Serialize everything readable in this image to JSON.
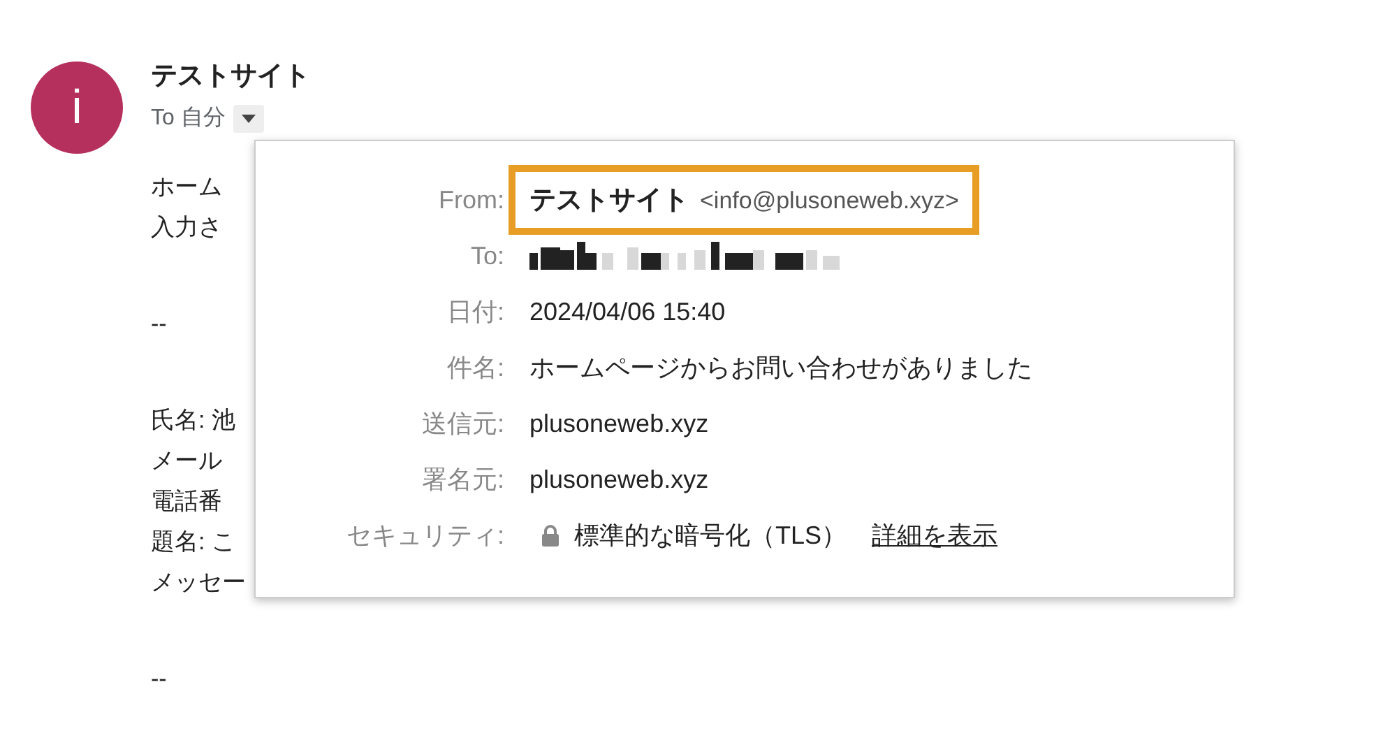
{
  "sender": {
    "avatar_letter": "i",
    "name": "テストサイト",
    "to_label": "To 自分"
  },
  "body_paragraphs": [
    [
      "ホーム",
      "入力さ"
    ],
    [
      "--"
    ],
    [
      "氏名: 池",
      "メール",
      "電話番",
      "題名: こ",
      "メッセー"
    ],
    [
      "--"
    ]
  ],
  "details": {
    "rows": [
      {
        "kind": "from",
        "label": "From:",
        "name": "テストサイト",
        "address": "<info@plusoneweb.xyz>",
        "highlighted": true
      },
      {
        "kind": "redacted",
        "label": "To:"
      },
      {
        "kind": "text",
        "label": "日付:",
        "value": "2024/04/06 15:40"
      },
      {
        "kind": "text",
        "label": "件名:",
        "value": "ホームページからお問い合わせがありました"
      },
      {
        "kind": "text",
        "label": "送信元:",
        "value": "plusoneweb.xyz"
      },
      {
        "kind": "text",
        "label": "署名元:",
        "value": "plusoneweb.xyz"
      },
      {
        "kind": "security",
        "label": "セキュリティ:",
        "value": "標準的な暗号化（TLS）",
        "link": "詳細を表示"
      }
    ]
  }
}
